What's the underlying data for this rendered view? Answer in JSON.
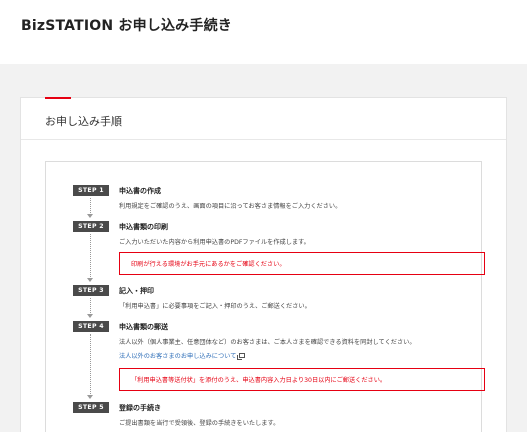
{
  "header": {
    "title": "BizSTATION お申し込み手続き"
  },
  "card": {
    "title": "お申し込み手順"
  },
  "steps": [
    {
      "badge": "STEP 1",
      "title": "申込書の作成",
      "desc": "利用規定をご確認のうえ、画面の項目に沿ってお客さま情報をご入力ください。"
    },
    {
      "badge": "STEP 2",
      "title": "申込書類の印刷",
      "desc": "ご入力いただいた内容から利用申込書のPDFファイルを作成します。",
      "alert": "印刷が行える環境がお手元にあるかをご確認ください。"
    },
    {
      "badge": "STEP 3",
      "title": "記入・押印",
      "desc": "「利用申込書」に必要事項をご記入・押印のうえ、ご郵送ください。"
    },
    {
      "badge": "STEP 4",
      "title": "申込書類の郵送",
      "desc": "法人以外（個人事業主、任意団体など）のお客さまは、ご本人さまを確認できる資料を同封してください。",
      "link": "法人以外のお客さまのお申し込みについて",
      "alert": "「利用申込書等送付状」を添付のうえ、申込書内容入力日より30日以内にご郵送ください。"
    },
    {
      "badge": "STEP 5",
      "title": "登録の手続き",
      "desc": "ご提出書類を当行で受領後、登録の手続きをいたします。"
    }
  ],
  "colors": {
    "accent": "#e60012",
    "badge": "#4a4a4a",
    "link": "#2e6eb8"
  }
}
